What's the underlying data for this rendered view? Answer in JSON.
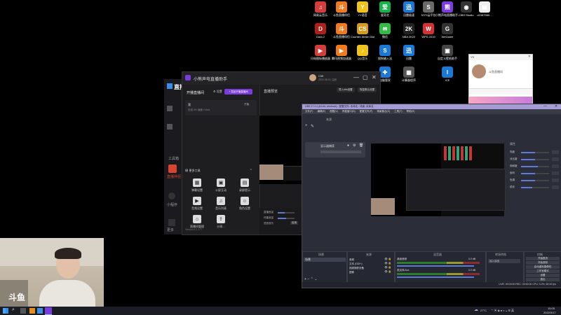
{
  "desktop": {
    "icons": [
      {
        "label": "网易云音乐",
        "icon": "music-app-icon",
        "color": "#d53c3c",
        "glyph": "♫"
      },
      {
        "label": "斗鱼直播伴侣",
        "icon": "douyu-icon",
        "color": "#f07a1d",
        "glyph": "斗"
      },
      {
        "label": "YY语音",
        "icon": "yy-icon",
        "color": "#f0c419",
        "glyph": "Y"
      },
      {
        "label": "爱奇艺",
        "icon": "iqiyi-icon",
        "color": "#16b34a",
        "glyph": "爱"
      },
      {
        "label": "迅雷极速",
        "icon": "xunlei-icon",
        "color": "#1a78d6",
        "glyph": "迅"
      },
      {
        "label": "SSTI云平台",
        "icon": "cloud-icon",
        "color": "#6a6a6a",
        "glyph": "S"
      },
      {
        "label": "小熊声电直播助手-4.1",
        "icon": "bear-icon",
        "color": "#7a3cdc",
        "glyph": "熊"
      },
      {
        "label": "OBS Studio",
        "icon": "obs-icon",
        "color": "#333",
        "glyph": "◉"
      },
      {
        "label": "d1987960...",
        "icon": "file-icon",
        "color": "#eee",
        "glyph": "▤"
      },
      {
        "label": "Dota 2",
        "icon": "dota-icon",
        "color": "#b0201a",
        "glyph": "D"
      },
      {
        "label": "斗鱼直播伴侣",
        "icon": "douyu-icon",
        "color": "#f07a1d",
        "glyph": "斗"
      },
      {
        "label": "Counter-Strike Global Off...",
        "icon": "csgo-icon",
        "color": "#d79a1c",
        "glyph": "CS"
      },
      {
        "label": "微信",
        "icon": "wechat-icon",
        "color": "#2fbb44",
        "glyph": "✉"
      },
      {
        "label": "NBA 2K22",
        "icon": "nba-icon",
        "color": "#222",
        "glyph": "2K"
      },
      {
        "label": "WPS 2019",
        "icon": "wps-icon",
        "color": "#d63131",
        "glyph": "W"
      },
      {
        "label": "WeGame",
        "icon": "wegame-icon",
        "color": "#333",
        "glyph": "G"
      },
      {
        "label": "闪电图标播放器",
        "icon": "player-icon",
        "color": "#d53c3c",
        "glyph": "▶"
      },
      {
        "label": "腾讯视频加速器",
        "icon": "video-icon",
        "color": "#f07a1d",
        "glyph": "▶"
      },
      {
        "label": "QQ音乐",
        "icon": "qq-music-icon",
        "color": "#f0c419",
        "glyph": "♪"
      },
      {
        "label": "搜狗输入法",
        "icon": "sogou-icon",
        "color": "#1a78d6",
        "glyph": "S"
      },
      {
        "label": "迅雷",
        "icon": "thunder-icon",
        "color": "#1a78d6",
        "glyph": "迅"
      },
      {
        "label": "自定义壁纸助手",
        "icon": "wallpaper-icon",
        "color": "#444",
        "glyph": "▣"
      },
      {
        "label": "电脑管家",
        "icon": "guard-icon",
        "color": "#1a78d6",
        "glyph": "✚"
      },
      {
        "label": "计算器程序",
        "icon": "calc-icon",
        "color": "#555",
        "glyph": "▦"
      },
      {
        "label": "ICE",
        "icon": "ice-icon",
        "color": "#1a78d6",
        "glyph": "I"
      }
    ]
  },
  "assistant_window": {
    "title": "小熊声电直播助手",
    "user_name": "Cliff",
    "user_sub": "2022-08-01 注册",
    "section_title": "开播直播间",
    "settings_label": "设置",
    "start_label": "+ 发起开播直播间",
    "room_name": "我",
    "room_sub": "在线 0%  速度 0 kb/s",
    "room_btn": "开播",
    "tools_title": "更多工具",
    "tools": [
      "弹幕设置",
      "公屏互动",
      "录屏提示",
      "音频设置",
      "音乐列表",
      "角色设置",
      "直播间管理",
      "分享..."
    ],
    "version": "Version 4.1.177",
    "preview_title": "直播预览",
    "preview_btn1": "导入obs设置",
    "preview_btn2": "恢复默认设置",
    "vol_label1": "直播音量",
    "vol_label2": "伴奏音量",
    "vol_label3": "混音音乐",
    "apply_label": "应用"
  },
  "left_window": {
    "logo_text": "直播",
    "side_items": [
      "工具箱",
      "直播伴侣",
      "小程序",
      "更多"
    ]
  },
  "obs_window": {
    "title": "OBS 27.2.4 (64-bit, windows) - 配置文件: 未命名 - 场景: 未命名",
    "menu": [
      "文件(F)",
      "编辑(E)",
      "视图(V)",
      "停靠窗口(D)",
      "配置文件(P)",
      "场景集合(S)",
      "工具(T)",
      "帮助(H)"
    ],
    "sources_header": "来源",
    "source_item": "显示器捕获",
    "scenes_header": "场景",
    "scene_item": "场景",
    "sources_list": [
      "音频",
      "文本 (GDI+)",
      "视频捕获设备",
      "图像"
    ],
    "mixer_header": "混音器",
    "mixer_items": [
      "桌面音频",
      "麦克风/Aux"
    ],
    "mixer_db": [
      "0.0 dB",
      "0.0 dB"
    ],
    "transitions_header": "转场特效",
    "transition_value": "淡入淡出",
    "controls_header": "控制",
    "controls": [
      "开始推流",
      "开始录制",
      "启动虚拟摄像机",
      "工作室模式",
      "设置",
      "退出"
    ],
    "status": "LIVE: 00:00:00  REC: 00:00:00  CPU: 3.2%, 60.00 fps",
    "right_panel_title": "属性",
    "right_labels": [
      "亮度",
      "对比度",
      "饱和度",
      "伽玛",
      "色调",
      "锐化"
    ]
  },
  "chat_panel": {
    "name": "Y9",
    "subtitle": "斗鱼直播间"
  },
  "taskbar": {
    "search_icon": "search-icon",
    "temperature": "27°C",
    "time": "15:05",
    "date": "2022/3/17"
  },
  "webcam": {
    "watermark": "斗鱼"
  }
}
